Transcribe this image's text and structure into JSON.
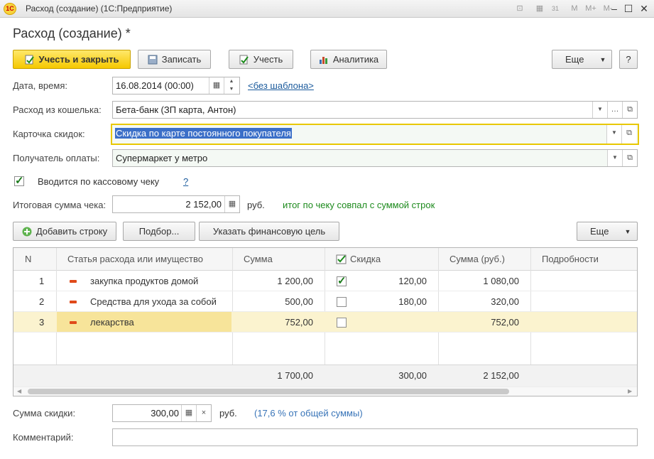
{
  "window": {
    "app_logo": "1С",
    "title": "Расход (создание)  (1С:Предприятие)",
    "tb_icons": [
      "⊡",
      "▦",
      "31",
      "M",
      "M+",
      "M-"
    ],
    "controls": {
      "minimize": "‒",
      "maximize": "☐",
      "close": "✕"
    }
  },
  "form": {
    "heading": "Расход (создание) *",
    "toolbar": {
      "post_and_close": "Учесть и закрыть",
      "write": "Записать",
      "post": "Учесть",
      "analytics": "Аналитика",
      "more": "Еще",
      "help": "?"
    },
    "fields": {
      "date_label": "Дата, время:",
      "date_value": "16.08.2014 (00:00)",
      "template_link": "<без шаблона>",
      "wallet_label": "Расход из кошелька:",
      "wallet_value": "Бета-банк (ЗП карта, Антон)",
      "card_label": "Карточка скидок:",
      "card_value": "Скидка по карте постоянного покупателя",
      "payee_label": "Получатель оплаты:",
      "payee_value": "Супермаркет у метро",
      "receipt_label": "Вводится по кассовому чеку",
      "receipt_help": "?",
      "total_label": "Итоговая сумма чека:",
      "total_value": "2 152,00",
      "total_unit": "руб.",
      "total_status": "итог по чеку совпал с суммой строк"
    },
    "table_toolbar": {
      "add_row": "Добавить строку",
      "select": "Подбор...",
      "fin_goal": "Указать финансовую цель",
      "more": "Еще"
    },
    "table": {
      "headers": {
        "n": "N",
        "item": "Статья расхода или имущество",
        "sum": "Сумма",
        "discount": "Скидка",
        "sum_rub": "Сумма (руб.)",
        "details": "Подробности"
      },
      "rows": [
        {
          "n": "1",
          "item": "закупка продуктов домой",
          "sum": "1 200,00",
          "discount_checked": true,
          "discount": "120,00",
          "sum_rub": "1 080,00"
        },
        {
          "n": "2",
          "item": "Средства для ухода за собой",
          "sum": "500,00",
          "discount_checked": false,
          "discount": "180,00",
          "sum_rub": "320,00"
        },
        {
          "n": "3",
          "item": "лекарства",
          "sum": "752,00",
          "discount_checked": false,
          "discount": "",
          "sum_rub": "752,00"
        }
      ],
      "footer": {
        "sum": "1 700,00",
        "discount": "300,00",
        "sum_rub": "2 152,00"
      }
    },
    "discount": {
      "label": "Сумма скидки:",
      "value": "300,00",
      "unit": "руб.",
      "note": "(17,6 % от общей суммы)"
    },
    "comment_label": "Комментарий:",
    "comment_value": ""
  },
  "colors": {
    "accent": "#f5c800",
    "selected_row": "#fbf3cf",
    "focus_border": "#e8c800",
    "status_green": "#1c8a1c"
  }
}
